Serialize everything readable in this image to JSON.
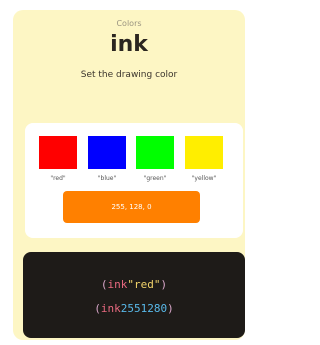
{
  "header": {
    "breadcrumb": "Colors",
    "title": "ink",
    "subtitle": "Set the drawing color"
  },
  "swatches": [
    {
      "label": "\"red\"",
      "color": "#ff0000"
    },
    {
      "label": "\"blue\"",
      "color": "#0000ff"
    },
    {
      "label": "\"green\"",
      "color": "#00ff00"
    },
    {
      "label": "\"yellow\"",
      "color": "#ffee00"
    }
  ],
  "rgb_button": {
    "label": "255, 128, 0",
    "color": "#ff8000"
  },
  "code": {
    "line1": {
      "open": "(",
      "fn": "ink",
      "arg": "\"red\"",
      "close": ")"
    },
    "line2": {
      "open": "(",
      "fn": "ink",
      "arg": "2551280",
      "close": ")"
    }
  },
  "colors": {
    "card_background": "#fdf6c4",
    "code_background": "#1e1b18"
  }
}
